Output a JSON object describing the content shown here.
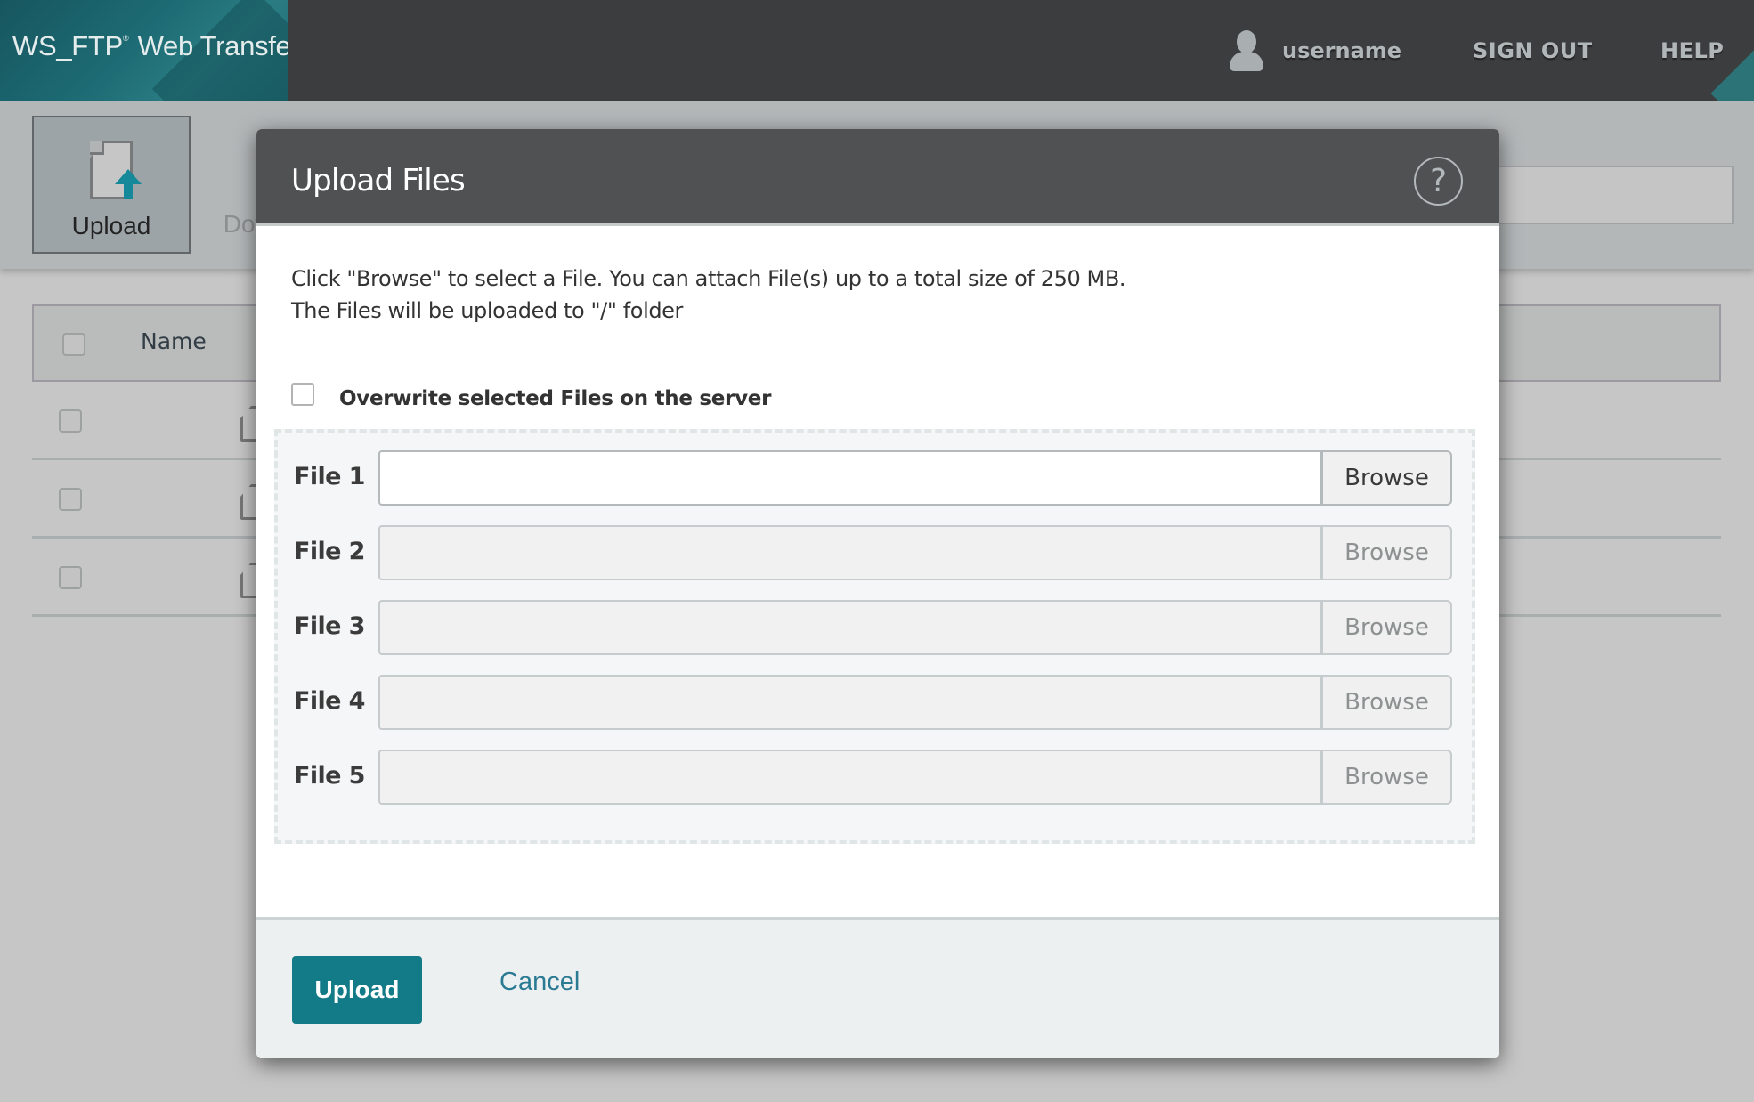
{
  "header": {
    "app_title": "WS_FTP",
    "app_title_mark": "®",
    "app_title_suffix": "Web Transfer",
    "username": "username",
    "sign_out": "SIGN OUT",
    "help": "HELP"
  },
  "toolbar": {
    "upload_label": "Upload",
    "download_label": "Download"
  },
  "table": {
    "columns": [
      "Name"
    ],
    "rows": [
      {},
      {},
      {}
    ]
  },
  "modal": {
    "title": "Upload Files",
    "help_icon": "?",
    "description_line1": "Click \"Browse\" to select a File. You can attach File(s) up to a total size of 250 MB.",
    "description_line2": "The Files will be uploaded to \"/\" folder",
    "overwrite_label": "Overwrite selected Files on the server",
    "overwrite_checked": false,
    "files": [
      {
        "label": "File 1",
        "value": "",
        "browse": "Browse",
        "enabled": true
      },
      {
        "label": "File 2",
        "value": "",
        "browse": "Browse",
        "enabled": false
      },
      {
        "label": "File 3",
        "value": "",
        "browse": "Browse",
        "enabled": false
      },
      {
        "label": "File 4",
        "value": "",
        "browse": "Browse",
        "enabled": false
      },
      {
        "label": "File 5",
        "value": "",
        "browse": "Browse",
        "enabled": false
      }
    ],
    "upload_button": "Upload",
    "cancel_button": "Cancel"
  },
  "colors": {
    "header_bg": "#3c3d3f",
    "accent": "#137a87",
    "link": "#2a7a93",
    "modal_header_bg": "#505153"
  }
}
